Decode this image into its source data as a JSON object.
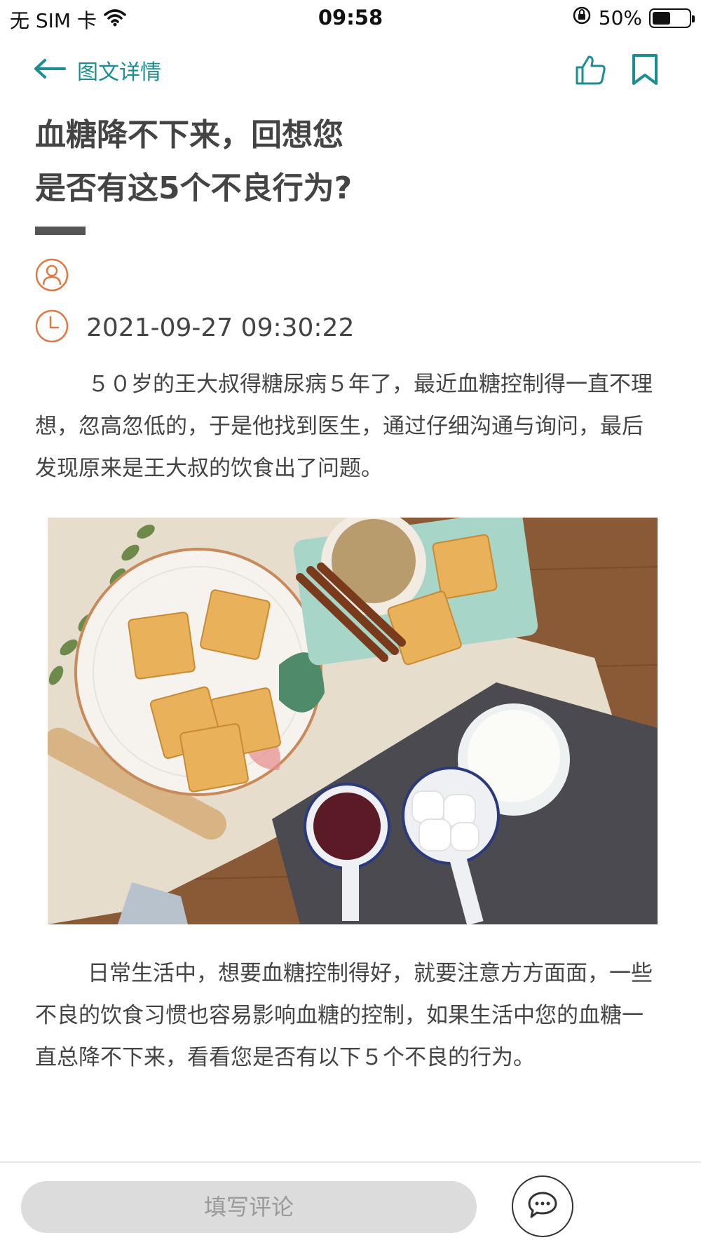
{
  "status_bar": {
    "carrier": "无 SIM 卡",
    "time": "09:58",
    "battery": "50%",
    "battery_level": 0.5,
    "icons": [
      "wifi-icon",
      "rotation-lock-icon",
      "battery-icon"
    ]
  },
  "nav": {
    "title": "图文详情",
    "icons": [
      "back-arrow-icon",
      "thumbs-up-icon",
      "bookmark-icon"
    ]
  },
  "article": {
    "title_line1": "血糖降不下来，回想您",
    "title_line2": "是否有这5个不良行为?",
    "author": "",
    "date": "2021-09-27 09:30:22",
    "paragraph1": "５０岁的王大叔得糖尿病５年了，最近血糖控制得一直不理想，忽高忽低的，于是他找到医生，通过仔细沟通与询问，最后发现原来是王大叔的饮食出了问题。",
    "paragraph2": "日常生活中，想要血糖控制得好，就要注意方方面面，一些不良的饮食习惯也容易影响血糖的控制，如果生活中您的血糖一直总降不下来，看看您是否有以下５个不良的行为。"
  },
  "bottom_bar": {
    "comment_placeholder": "填写评论",
    "icons": [
      "comment-bubble-icon"
    ]
  },
  "colors": {
    "accent_teal": "#1a8e93",
    "accent_orange": "#e07a45",
    "title_gray": "#444444"
  }
}
